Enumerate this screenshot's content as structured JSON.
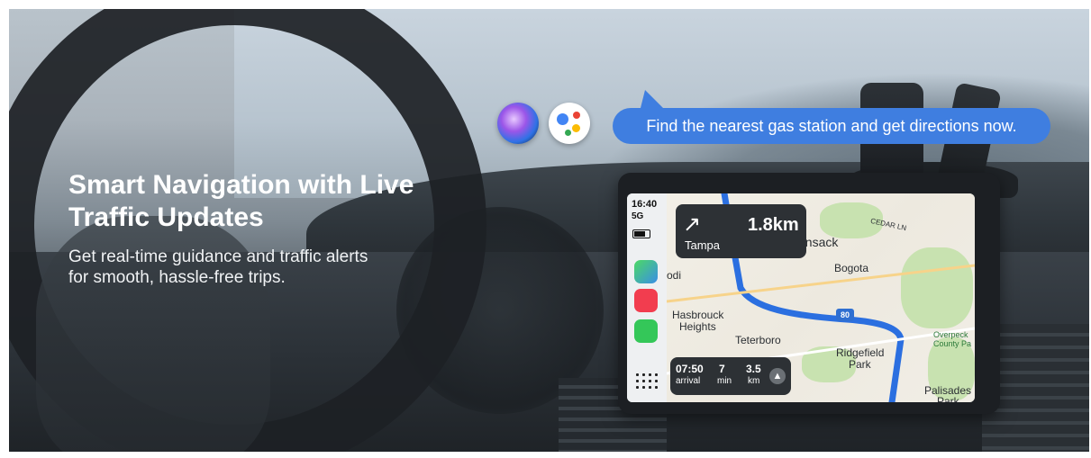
{
  "headline": {
    "line1": "Smart Navigation with Live",
    "line2": "Traffic Updates"
  },
  "subheadline": {
    "line1": "Get real-time guidance and traffic alerts",
    "line2": "for smooth, hassle-free trips."
  },
  "voice_bubble": "Find the nearest gas station and get directions now.",
  "voice_assistants": [
    "siri-icon",
    "google-assistant-icon"
  ],
  "device": {
    "status": {
      "time": "16:40",
      "signal": "5G"
    },
    "dock_apps": [
      "maps-icon",
      "music-icon",
      "messages-icon",
      "app-grid-icon"
    ],
    "turn": {
      "icon": "turn-right-arrow-icon",
      "distance": "1.8km",
      "street": "Tampa"
    },
    "compass": "N",
    "map_labels": [
      "ensack",
      "Bogota",
      "CEDAR LN",
      "odi",
      "Hasbrouck",
      "Heights",
      "Teterboro",
      "Ridgefield",
      "Park",
      "Overpeck",
      "County Pa",
      "Palisades",
      "Park"
    ],
    "highway_shield": "80",
    "eta": {
      "arrival_value": "07:50",
      "arrival_label": "arrival",
      "minutes_value": "7",
      "minutes_label": "min",
      "distance_value": "3.5",
      "distance_label": "km"
    }
  },
  "colors": {
    "bubble": "#3f7ee0",
    "route": "#2b6fe0",
    "headline": "#ffffff"
  }
}
